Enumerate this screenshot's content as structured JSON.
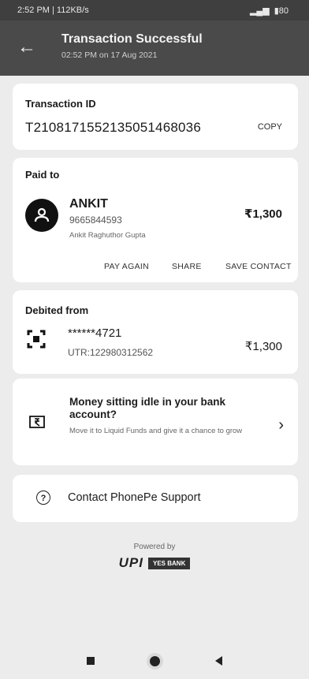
{
  "status_bar": {
    "time_speed": "2:52 PM | 112KB/s",
    "battery": "80"
  },
  "header": {
    "title": "Transaction Successful",
    "subtitle": "02:52 PM on 17 Aug 2021"
  },
  "transaction": {
    "label": "Transaction ID",
    "id": "T2108171552135051468036",
    "copy_label": "COPY"
  },
  "paid_to": {
    "label": "Paid to",
    "name": "ANKIT",
    "phone": "9665844593",
    "bank_name": "Ankit Raghuthor Gupta",
    "amount": "₹1,300",
    "actions": [
      "PAY AGAIN",
      "SHARE",
      "SAVE CONTACT"
    ]
  },
  "debited_from": {
    "label": "Debited from",
    "account": "******4721",
    "utr": "UTR:122980312562",
    "amount": "₹1,300"
  },
  "promo": {
    "title": "Money sitting idle in your bank account?",
    "description": "Move it to Liquid Funds and give it a chance to grow"
  },
  "support": {
    "label": "Contact PhonePe Support",
    "icon_text": "?"
  },
  "footer": {
    "powered_by": "Powered by",
    "upi": "UPI",
    "bank": "YES BANK"
  },
  "icons": {
    "back": "back-arrow-icon",
    "avatar": "person-icon",
    "bank": "bank-scan-icon",
    "promo": "rupee-wallet-icon",
    "help": "help-circle-icon"
  }
}
